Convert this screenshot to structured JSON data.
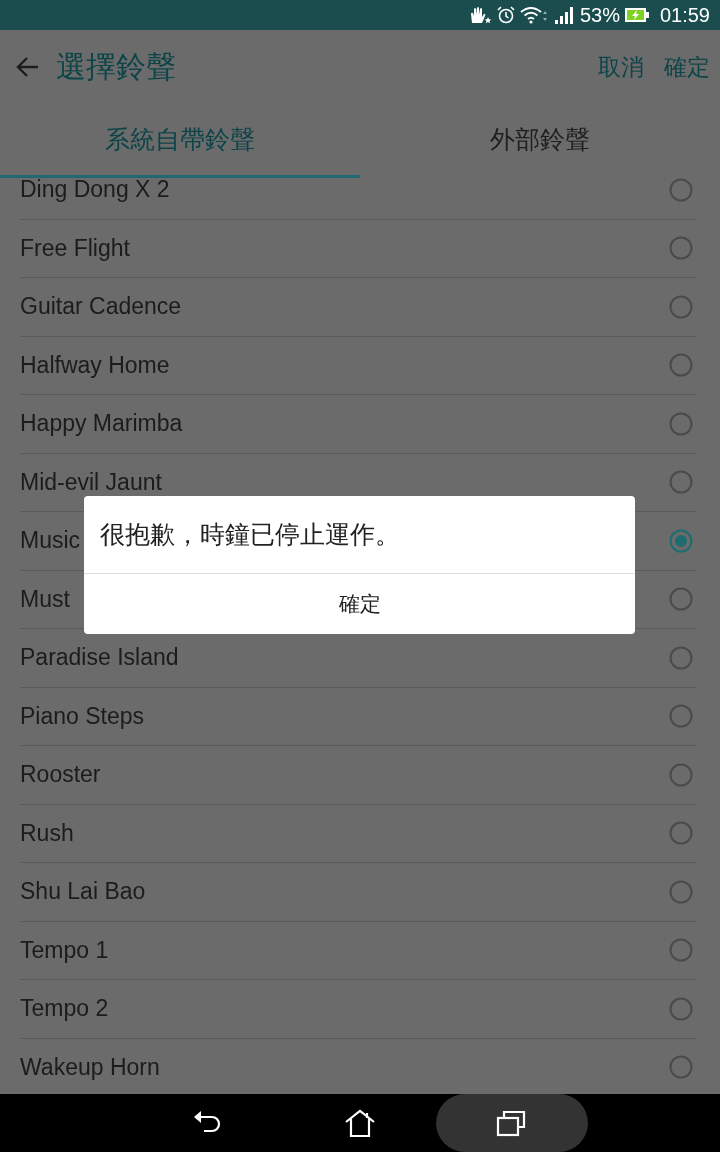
{
  "status_bar": {
    "battery": "53%",
    "time": "01:59"
  },
  "header": {
    "title": "選擇鈴聲",
    "actions": [
      "取消",
      "確定"
    ]
  },
  "tabs": [
    {
      "label": "系統自帶鈴聲",
      "selected": true
    },
    {
      "label": "外部鈴聲",
      "selected": false
    }
  ],
  "ringtones": [
    {
      "name": "Ding Dong X 2",
      "selected": false
    },
    {
      "name": "Free Flight",
      "selected": false
    },
    {
      "name": "Guitar Cadence",
      "selected": false
    },
    {
      "name": "Halfway Home",
      "selected": false
    },
    {
      "name": "Happy Marimba",
      "selected": false
    },
    {
      "name": "Mid-evil Jaunt",
      "selected": false
    },
    {
      "name": "Music",
      "selected": true
    },
    {
      "name": "Must",
      "selected": false
    },
    {
      "name": "Paradise Island",
      "selected": false
    },
    {
      "name": "Piano Steps",
      "selected": false
    },
    {
      "name": "Rooster",
      "selected": false
    },
    {
      "name": "Rush",
      "selected": false
    },
    {
      "name": "Shu Lai Bao",
      "selected": false
    },
    {
      "name": "Tempo 1",
      "selected": false
    },
    {
      "name": "Tempo 2",
      "selected": false
    },
    {
      "name": "Wakeup Horn",
      "selected": false
    }
  ],
  "dialog": {
    "message": "很抱歉，時鐘已停止運作。",
    "button": "確定"
  }
}
